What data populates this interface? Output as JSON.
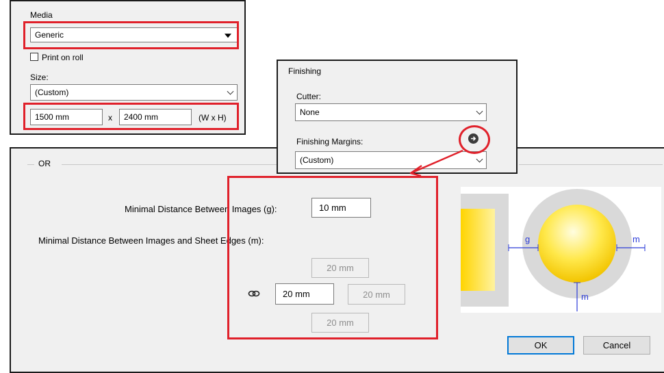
{
  "media_panel": {
    "title": "Media",
    "media_value": "Generic",
    "print_on_roll_label": "Print on roll",
    "print_on_roll_checked": false,
    "size_label": "Size:",
    "size_value": "(Custom)",
    "width_value": "1500 mm",
    "x_label": "x",
    "height_value": "2400 mm",
    "wxh_label": "(W x H)"
  },
  "finishing_panel": {
    "title": "Finishing",
    "cutter_label": "Cutter:",
    "cutter_value": "None",
    "margins_label": "Finishing Margins:",
    "margins_value": "(Custom)"
  },
  "main_panel": {
    "group_title": "OR",
    "min_distance_label": "Minimal Distance Between Images (g):",
    "min_distance_value": "10 mm",
    "edges_label": "Minimal Distance Between Images and Sheet Edges (m):",
    "edge_top": "20 mm",
    "edge_left": "20 mm",
    "edge_right": "20 mm",
    "edge_bottom": "20 mm",
    "ok_label": "OK",
    "cancel_label": "Cancel"
  },
  "diagram": {
    "label_g": "g",
    "label_m_right": "m",
    "label_m_bottom": "m"
  },
  "colors": {
    "highlight_red": "#e0202a",
    "panel_bg": "#f0f0f0",
    "accent_blue": "#0078d7",
    "diagram_yellow": "#ffe033",
    "diagram_gray": "#d9d9d9"
  }
}
